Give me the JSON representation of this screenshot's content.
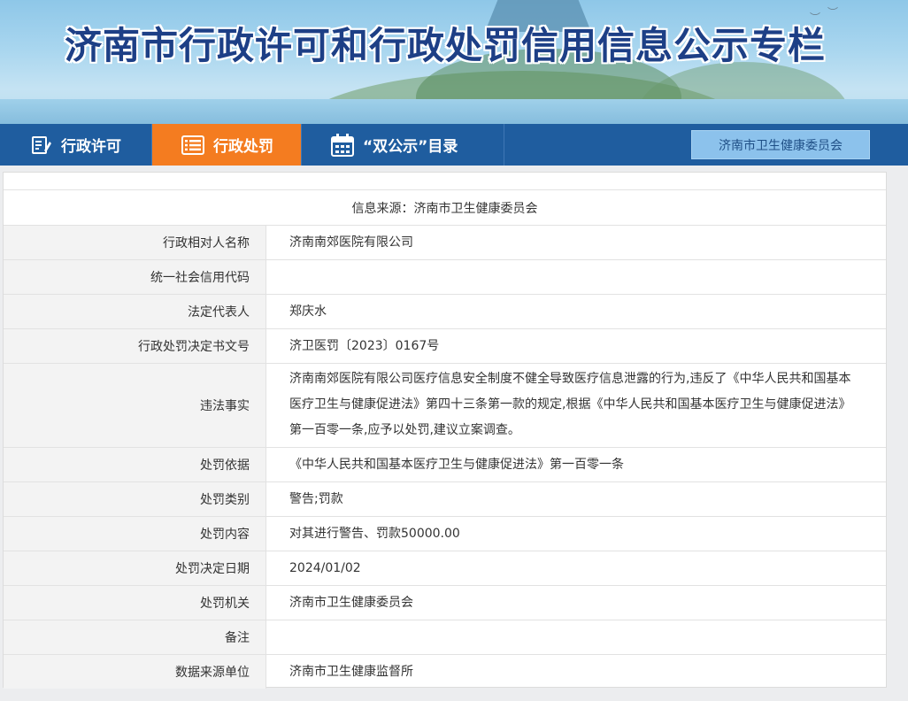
{
  "banner": {
    "title": "济南市行政许可和行政处罚信用信息公示专栏"
  },
  "nav": {
    "items": [
      {
        "label": "行政许可",
        "icon": "form-icon",
        "active": false
      },
      {
        "label": "行政处罚",
        "icon": "list-icon",
        "active": true
      },
      {
        "label": "“双公示”目录",
        "icon": "calendar-icon",
        "active": false
      }
    ],
    "department": "济南市卫生健康委员会"
  },
  "record": {
    "source": "信息来源：济南市卫生健康委员会",
    "fields": [
      {
        "label": "行政相对人名称",
        "value": "济南南郊医院有限公司"
      },
      {
        "label": "统一社会信用代码",
        "value": ""
      },
      {
        "label": "法定代表人",
        "value": "郑庆水"
      },
      {
        "label": "行政处罚决定书文号",
        "value": "济卫医罚〔2023〕0167号"
      },
      {
        "label": "违法事实",
        "value": "济南南郊医院有限公司医疗信息安全制度不健全导致医疗信息泄露的行为,违反了《中华人民共和国基本医疗卫生与健康促进法》第四十三条第一款的规定,根据《中华人民共和国基本医疗卫生与健康促进法》第一百零一条,应予以处罚,建议立案调查。"
      },
      {
        "label": "处罚依据",
        "value": "《中华人民共和国基本医疗卫生与健康促进法》第一百零一条"
      },
      {
        "label": "处罚类别",
        "value": "警告;罚款"
      },
      {
        "label": "处罚内容",
        "value": "对其进行警告、罚款50000.00"
      },
      {
        "label": "处罚决定日期",
        "value": "2024/01/02"
      },
      {
        "label": "处罚机关",
        "value": "济南市卫生健康委员会"
      },
      {
        "label": "备注",
        "value": ""
      },
      {
        "label": "数据来源单位",
        "value": "济南市卫生健康监督所"
      }
    ]
  },
  "colors": {
    "title": "#1d3f86",
    "nav_bg": "#1f5d9f",
    "nav_active": "#f47c20",
    "dept_button": "#8cc2ec"
  }
}
